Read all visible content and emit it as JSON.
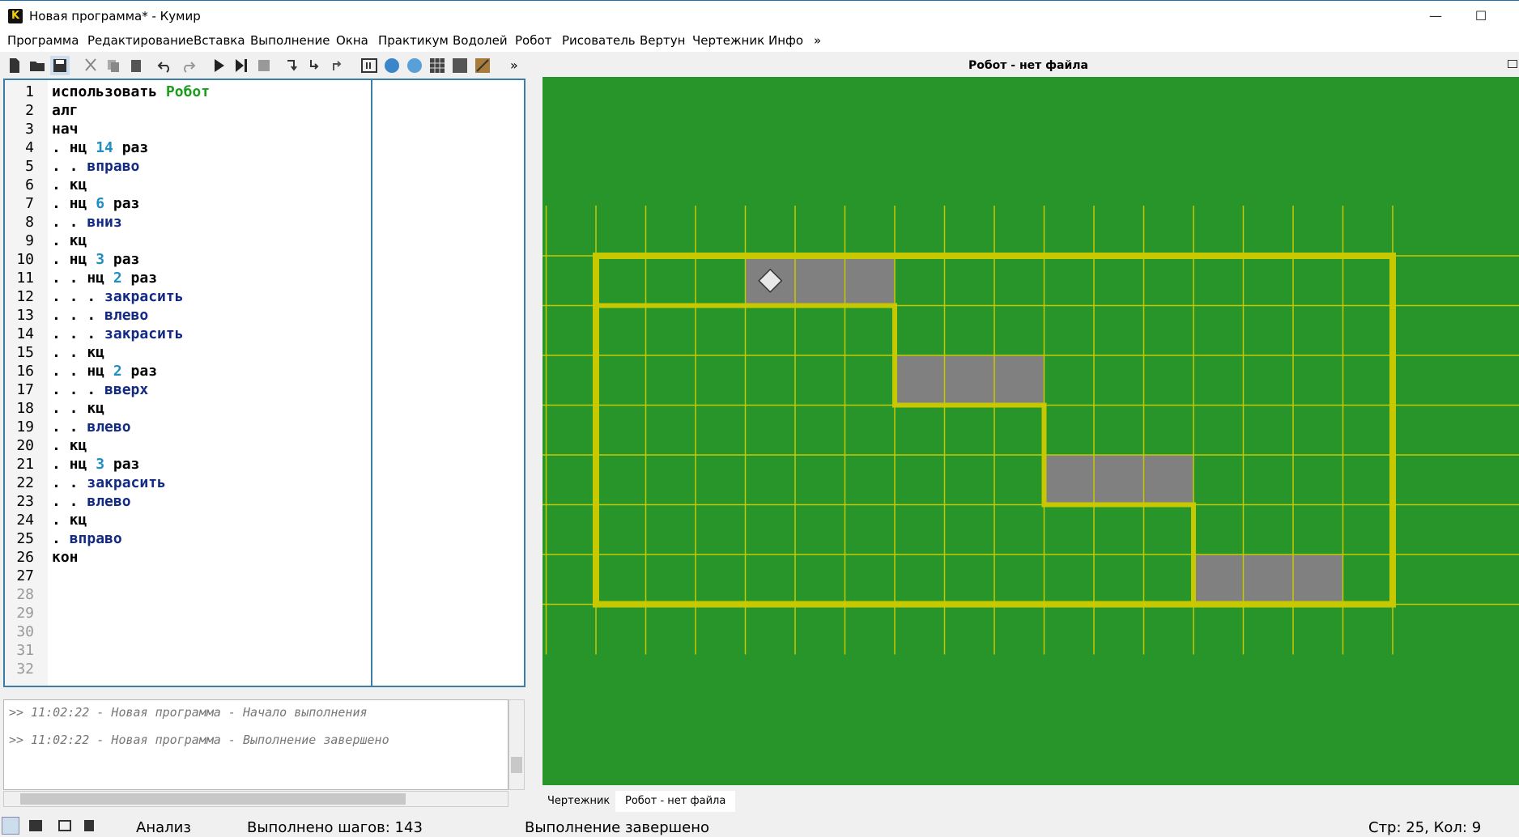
{
  "window": {
    "title": "Новая программа* - Кумир",
    "app_letter": "K",
    "minimize": "—",
    "maximize": "☐"
  },
  "menu": [
    "Программа",
    "Редактирование",
    "Вставка",
    "Выполнение",
    "Окна",
    "Практикум",
    "Водолей",
    "Робот",
    "Рисователь",
    "Вертун",
    "Чертежник",
    "Инфо",
    "»"
  ],
  "toolbar": {
    "overflow": "»"
  },
  "editor": {
    "line_numbers": [
      "1",
      "2",
      "3",
      "4",
      "5",
      "6",
      "7",
      "8",
      "9",
      "10",
      "11",
      "12",
      "13",
      "14",
      "15",
      "16",
      "17",
      "18",
      "19",
      "20",
      "21",
      "22",
      "23",
      "24",
      "25",
      "26",
      "27",
      "28",
      "29",
      "30",
      "31",
      "32"
    ],
    "lines": [
      [
        {
          "t": "использовать ",
          "c": ""
        },
        {
          "t": "Робот",
          "c": "kw-g"
        }
      ],
      [
        {
          "t": "алг",
          "c": ""
        }
      ],
      [
        {
          "t": "нач",
          "c": ""
        }
      ],
      [
        {
          "t": ". нц ",
          "c": ""
        },
        {
          "t": "14",
          "c": "num"
        },
        {
          "t": " раз",
          "c": ""
        }
      ],
      [
        {
          "t": ". . ",
          "c": ""
        },
        {
          "t": "вправо",
          "c": "kw-b"
        }
      ],
      [
        {
          "t": ". кц",
          "c": ""
        }
      ],
      [
        {
          "t": ". нц ",
          "c": ""
        },
        {
          "t": "6",
          "c": "num"
        },
        {
          "t": " раз",
          "c": ""
        }
      ],
      [
        {
          "t": ". . ",
          "c": ""
        },
        {
          "t": "вниз",
          "c": "kw-b"
        }
      ],
      [
        {
          "t": ". кц",
          "c": ""
        }
      ],
      [
        {
          "t": ". нц ",
          "c": ""
        },
        {
          "t": "3",
          "c": "num"
        },
        {
          "t": " раз",
          "c": ""
        }
      ],
      [
        {
          "t": ". . нц ",
          "c": ""
        },
        {
          "t": "2",
          "c": "num"
        },
        {
          "t": " раз",
          "c": ""
        }
      ],
      [
        {
          "t": ". . . ",
          "c": ""
        },
        {
          "t": "закрасить",
          "c": "kw-b"
        }
      ],
      [
        {
          "t": ". . . ",
          "c": ""
        },
        {
          "t": "влево",
          "c": "kw-b"
        }
      ],
      [
        {
          "t": ". . . ",
          "c": ""
        },
        {
          "t": "закрасить",
          "c": "kw-b"
        }
      ],
      [
        {
          "t": ". . кц",
          "c": ""
        }
      ],
      [
        {
          "t": ". . нц ",
          "c": ""
        },
        {
          "t": "2",
          "c": "num"
        },
        {
          "t": " раз",
          "c": ""
        }
      ],
      [
        {
          "t": ". . . ",
          "c": ""
        },
        {
          "t": "вверх",
          "c": "kw-b"
        }
      ],
      [
        {
          "t": ". . кц",
          "c": ""
        }
      ],
      [
        {
          "t": ". . ",
          "c": ""
        },
        {
          "t": "влево",
          "c": "kw-b"
        }
      ],
      [
        {
          "t": ". кц",
          "c": ""
        }
      ],
      [
        {
          "t": ". нц ",
          "c": ""
        },
        {
          "t": "3",
          "c": "num"
        },
        {
          "t": " раз",
          "c": ""
        }
      ],
      [
        {
          "t": ". . ",
          "c": ""
        },
        {
          "t": "закрасить",
          "c": "kw-b"
        }
      ],
      [
        {
          "t": ". . ",
          "c": ""
        },
        {
          "t": "влево",
          "c": "kw-b"
        }
      ],
      [
        {
          "t": ". кц",
          "c": ""
        }
      ],
      [
        {
          "t": ". ",
          "c": ""
        },
        {
          "t": "вправо",
          "c": "kw-b"
        }
      ],
      [
        {
          "t": "кон",
          "c": ""
        }
      ]
    ]
  },
  "console": {
    "lines": [
      ">> 11:02:22 - Новая программа - Начало выполнения",
      ">> 11:02:22 - Новая программа - Выполнение завершено"
    ]
  },
  "robot_panel": {
    "title": "Робот - нет файла",
    "colors": {
      "field": "#27952a",
      "wall": "#c8c800",
      "grid": "#c8c800",
      "painted": "#808080"
    },
    "painted_cells": [
      [
        3,
        0
      ],
      [
        4,
        0
      ],
      [
        5,
        0
      ],
      [
        6,
        2
      ],
      [
        7,
        2
      ],
      [
        8,
        2
      ],
      [
        9,
        4
      ],
      [
        10,
        4
      ],
      [
        11,
        4
      ],
      [
        12,
        6
      ],
      [
        13,
        6
      ],
      [
        14,
        6
      ]
    ],
    "robot_cell": [
      3,
      0
    ]
  },
  "tabs": [
    "Чертежник",
    "Робот - нет файла"
  ],
  "status": {
    "mode": "Анализ",
    "steps": "Выполнено шагов: 143",
    "state": "Выполнение завершено",
    "cursor": "Стр: 25, Кол: 9"
  }
}
